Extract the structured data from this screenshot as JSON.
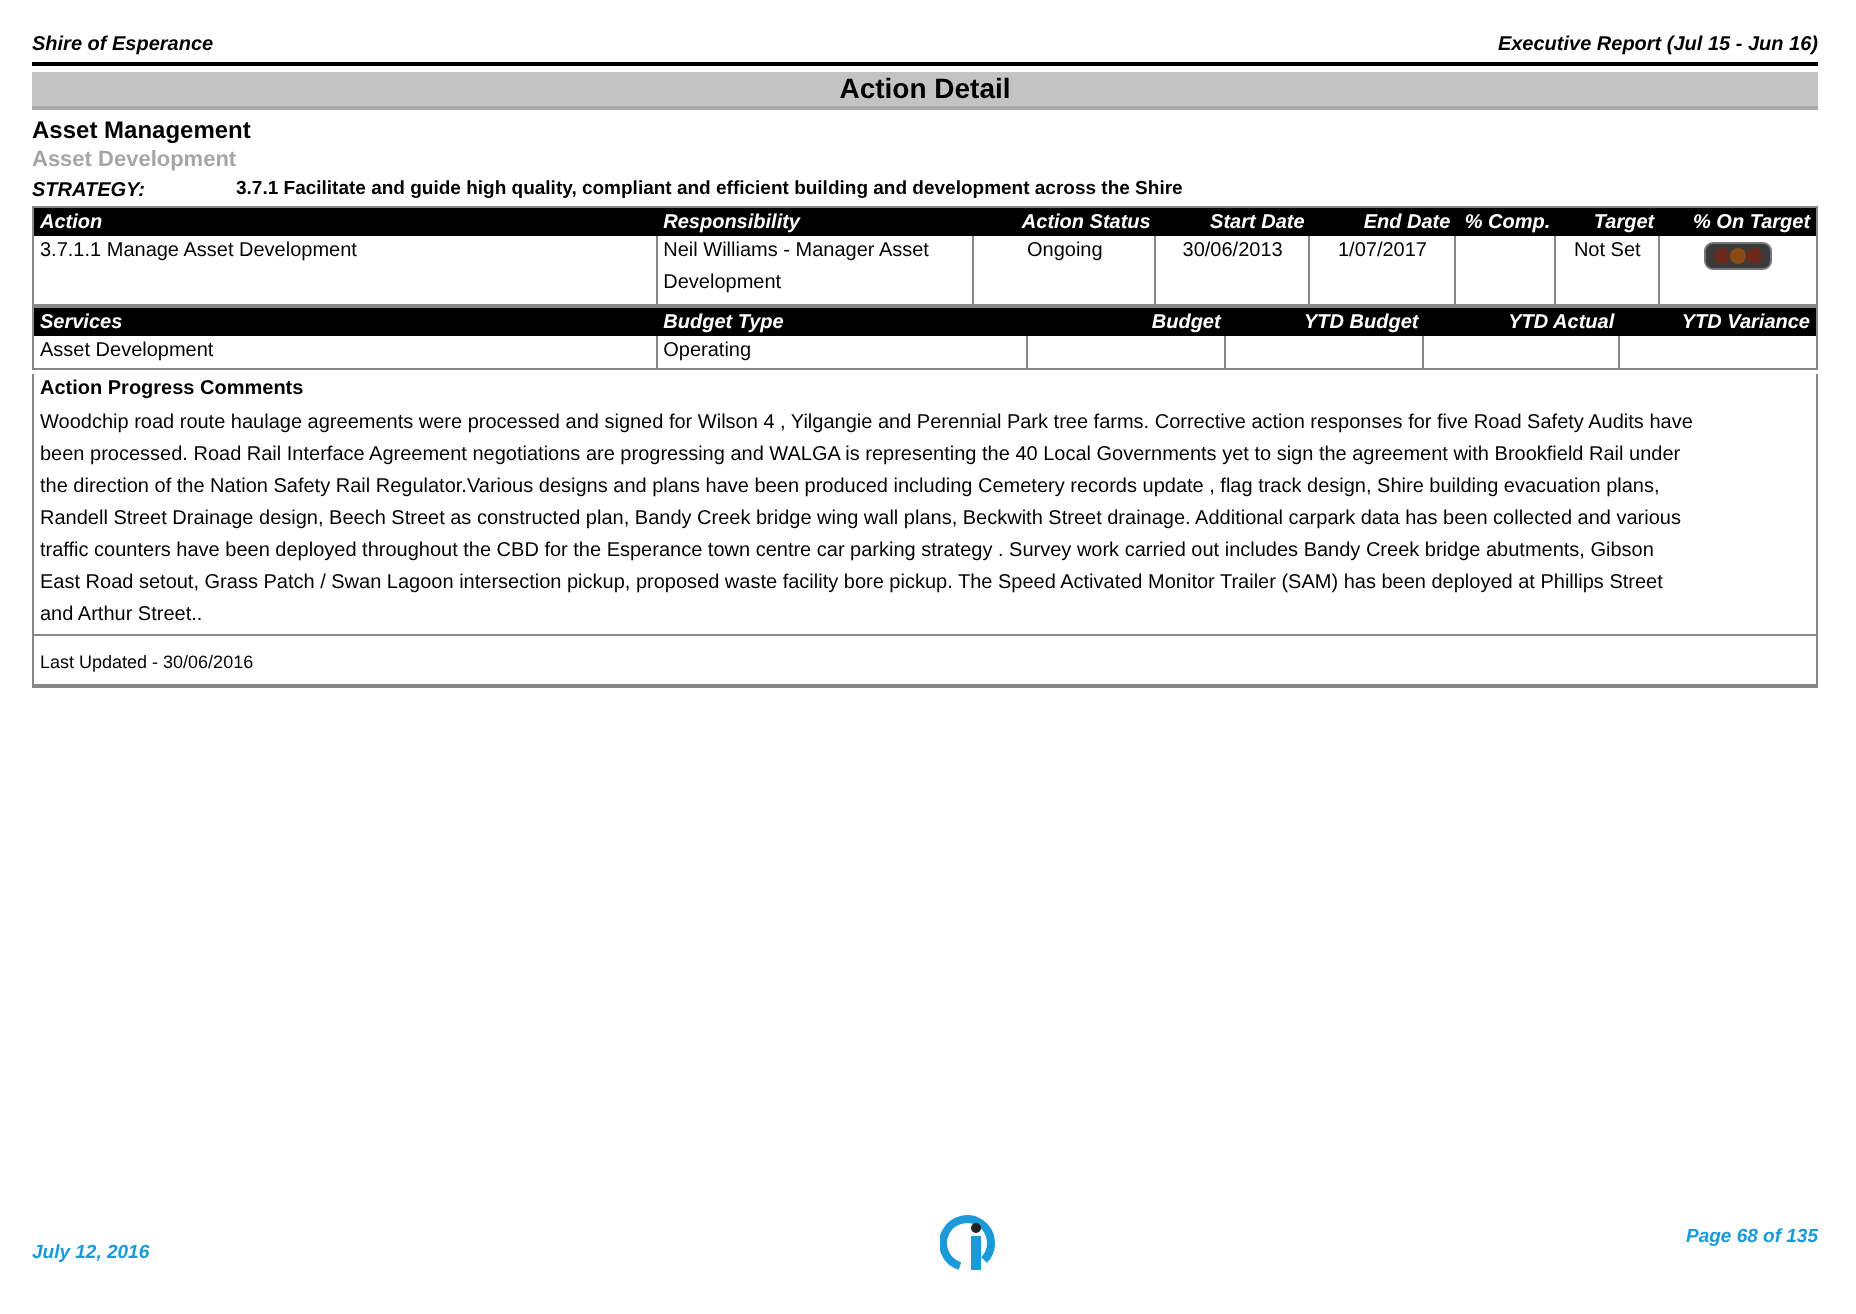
{
  "header": {
    "organisation": "Shire of Esperance",
    "report": "Executive Report (Jul 15 - Jun 16)"
  },
  "title": "Action Detail",
  "section": "Asset Management",
  "subsection": "Asset Development",
  "strategy": {
    "label": "STRATEGY:",
    "text": "3.7.1 Facilitate and guide high quality, compliant and efficient building and development across the Shire"
  },
  "action_table": {
    "columns": [
      "Action",
      "Responsibility",
      "Action Status",
      "Start Date",
      "End Date",
      "% Comp.",
      "Target",
      "% On Target"
    ],
    "rows": [
      [
        "3.7.1.1 Manage Asset Development",
        "Neil Williams - Manager Asset Development",
        "Ongoing",
        "30/06/2013",
        "1/07/2017",
        "",
        "Not Set",
        ""
      ]
    ]
  },
  "services_table": {
    "columns": [
      "Services",
      "Budget Type",
      "Budget",
      "YTD Budget",
      "YTD Actual",
      "YTD Variance"
    ],
    "rows": [
      [
        "Asset Development",
        "Operating",
        "",
        "",
        "",
        ""
      ]
    ]
  },
  "comments": {
    "heading": "Action Progress Comments",
    "lines": [
      "Woodchip road route haulage agreements were processed and signed for Wilson 4 , Yilgangie and Perennial Park tree farms. Corrective action responses for five Road Safety Audits have",
      "been processed. Road Rail Interface Agreement negotiations are progressing and WALGA is representing the 40 Local Governments yet to sign the agreement with Brookfield Rail under",
      "the direction of the Nation Safety Rail Regulator.Various designs and plans have been produced including Cemetery records update , flag track design, Shire building evacuation plans,",
      "Randell Street Drainage design, Beech Street as constructed plan, Bandy Creek bridge wing wall plans, Beckwith Street drainage. Additional carpark data has been collected and various",
      "traffic counters have been deployed throughout the CBD for the Esperance town centre car parking strategy . Survey work carried out includes Bandy Creek bridge abutments, Gibson",
      "East Road setout, Grass Patch / Swan Lagoon intersection pickup, proposed waste facility bore pickup. The Speed Activated Monitor Trailer (SAM) has been deployed at Phillips Street",
      "and Arthur Street.."
    ],
    "last_updated": "Last Updated - 30/06/2016"
  },
  "footer": {
    "date": "July 12, 2016",
    "page": "Page 68 of 135"
  }
}
